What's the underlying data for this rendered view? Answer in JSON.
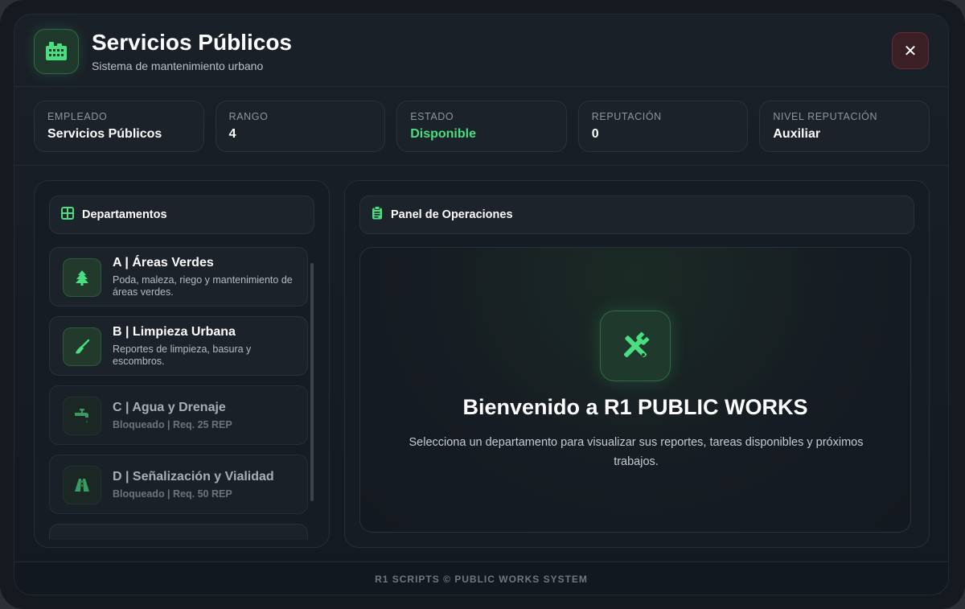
{
  "header": {
    "title": "Servicios Públicos",
    "subtitle": "Sistema de mantenimiento urbano",
    "logo_icon": "building-icon",
    "close_label": "✕"
  },
  "stats": [
    {
      "label": "EMPLEADO",
      "value": "Servicios Públicos"
    },
    {
      "label": "RANGO",
      "value": "4"
    },
    {
      "label": "ESTADO",
      "value": "Disponible"
    },
    {
      "label": "REPUTACIÓN",
      "value": "0"
    },
    {
      "label": "NIVEL REPUTACIÓN",
      "value": "Auxiliar"
    }
  ],
  "departments_panel": {
    "title": "Departamentos",
    "icon": "grid-icon",
    "items": [
      {
        "name": "A | Áreas Verdes",
        "description": "Poda, maleza, riego y mantenimiento de áreas verdes.",
        "icon": "tree-icon",
        "locked": false
      },
      {
        "name": "B | Limpieza Urbana",
        "description": "Reportes de limpieza, basura y escombros.",
        "icon": "broom-icon",
        "locked": false
      },
      {
        "name": "C | Agua y Drenaje",
        "description": "Bloqueado | Req. 25 REP",
        "icon": "faucet-icon",
        "locked": true
      },
      {
        "name": "D | Señalización y Vialidad",
        "description": "Bloqueado | Req. 50 REP",
        "icon": "road-icon",
        "locked": true
      }
    ]
  },
  "operations_panel": {
    "title": "Panel de Operaciones",
    "icon": "clipboard-icon",
    "welcome_icon": "tools-icon",
    "welcome_title": "Bienvenido a R1 PUBLIC WORKS",
    "welcome_text": "Selecciona un departamento para visualizar sus reportes, tareas disponibles y próximos trabajos."
  },
  "footer": {
    "text": "R1 SCRIPTS © PUBLIC WORKS SYSTEM"
  },
  "colors": {
    "accent": "#4ade80",
    "background": "#151a20",
    "danger": "#6b2a33"
  }
}
